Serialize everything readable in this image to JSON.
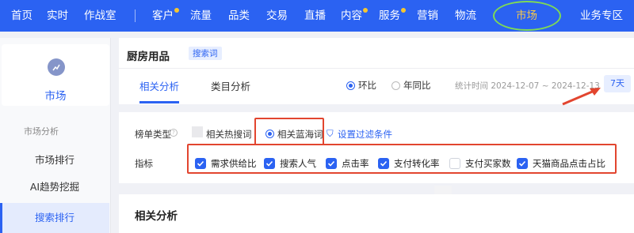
{
  "nav": {
    "items": [
      "首页",
      "实时",
      "作战室",
      "客户",
      "流量",
      "品类",
      "交易",
      "直播",
      "内容",
      "服务",
      "营销",
      "物流",
      "市场",
      "业务专区"
    ],
    "active": "市场"
  },
  "sidebar": {
    "module": "市场",
    "section": "市场分析",
    "items": [
      "市场排行",
      "AI趋势挖掘",
      "搜索排行"
    ],
    "active": "搜索排行"
  },
  "page": {
    "title": "厨房用品",
    "tag": "搜索词",
    "tabs": [
      "相关分析",
      "类目分析"
    ],
    "compare": [
      "环比",
      "年同比"
    ],
    "stat_time": "统计时间 2024-12-07 ~ 2024-12-13",
    "range": "7天"
  },
  "filters": {
    "list_type_label": "榜单类型",
    "list_types": [
      "相关热搜词",
      "相关蓝海词"
    ],
    "selected_type": "相关蓝海词",
    "filter_link": "设置过滤条件",
    "metric_label": "指标",
    "metrics": [
      {
        "label": "需求供给比",
        "checked": true
      },
      {
        "label": "搜索人气",
        "checked": true
      },
      {
        "label": "点击率",
        "checked": true
      },
      {
        "label": "支付转化率",
        "checked": true
      },
      {
        "label": "支付买家数",
        "checked": false
      },
      {
        "label": "天猫商品点击占比",
        "checked": true
      }
    ]
  },
  "section": {
    "title": "相关分析"
  },
  "colors": {
    "brand": "#2b62f2",
    "highlight_box": "#e2452f",
    "ellipse": "#7ed957",
    "nav_dot": "#f5c62f"
  }
}
